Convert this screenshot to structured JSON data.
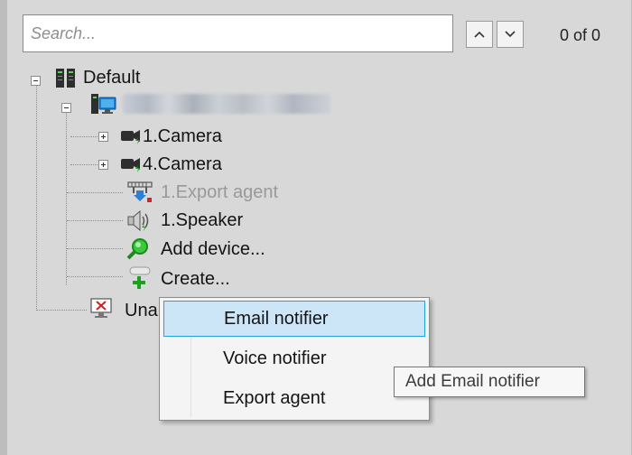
{
  "search": {
    "placeholder": "Search...",
    "value": ""
  },
  "navigation": {
    "match_count": "0 of 0"
  },
  "tree": {
    "root_label": "Default",
    "children": [
      {
        "label": "1.Camera",
        "icon": "camera-icon"
      },
      {
        "label": "4.Camera",
        "icon": "camera-icon"
      },
      {
        "label": "1.Export agent",
        "icon": "export-agent-icon",
        "disabled": true
      },
      {
        "label": "1.Speaker",
        "icon": "speaker-icon"
      },
      {
        "label": "Add device...",
        "icon": "magnifier-add-icon"
      },
      {
        "label": "Create...",
        "icon": "create-icon"
      }
    ],
    "unassigned_label": "Una"
  },
  "context_menu": {
    "items": [
      {
        "label": "Email notifier",
        "highlighted": true
      },
      {
        "label": "Voice notifier"
      },
      {
        "label": "Export agent"
      }
    ]
  },
  "tooltip": {
    "text": "Add Email notifier"
  },
  "colors": {
    "panel_bg": "#d8d8d8",
    "menu_highlight_bg": "#cde6f7",
    "menu_highlight_border": "#26a0da",
    "status_green": "#1aa31a",
    "status_red": "#e02020"
  }
}
